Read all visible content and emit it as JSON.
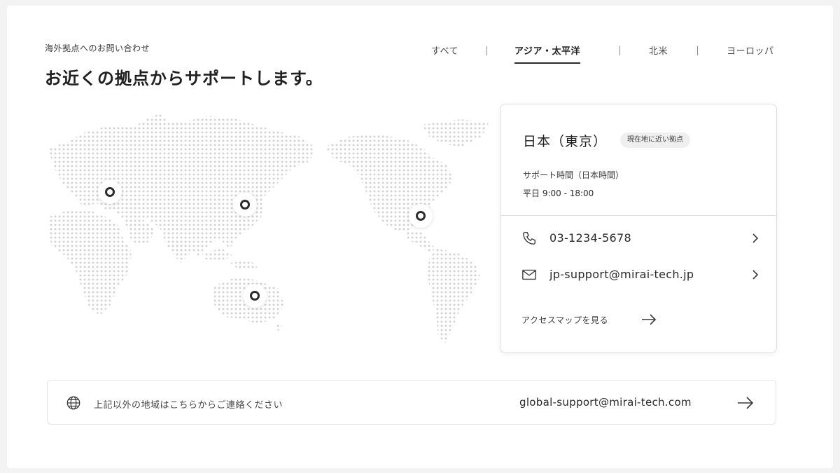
{
  "header": {
    "eyebrow": "海外拠点へのお問い合わせ",
    "title": "お近くの拠点からサポートします。"
  },
  "tabs": [
    {
      "label": "すべて",
      "active": false
    },
    {
      "label": "アジア・太平洋",
      "active": true
    },
    {
      "label": "北米",
      "active": false
    },
    {
      "label": "ヨーロッパ",
      "active": false
    }
  ],
  "map": {
    "pins": [
      "europe-pin",
      "japan-pin",
      "north-america-pin",
      "australia-pin"
    ]
  },
  "location_card": {
    "title": "日本（東京）",
    "badge": "現在地に近い拠点",
    "hours_label": "サポート時間（日本時間）",
    "hours_value": "平日 9:00 - 18:00",
    "phone": "03-1234-5678",
    "email": "jp-support@mirai-tech.jp",
    "access_link": "アクセスマップを見る"
  },
  "footer_bar": {
    "message": "上記以外の地域はこちらからご連絡ください",
    "email": "global-support@mirai-tech.com"
  },
  "colors": {
    "text": "#2a2a2a",
    "border": "#dedede",
    "map_dots": "#cfcfcf",
    "background": "#ffffff"
  }
}
